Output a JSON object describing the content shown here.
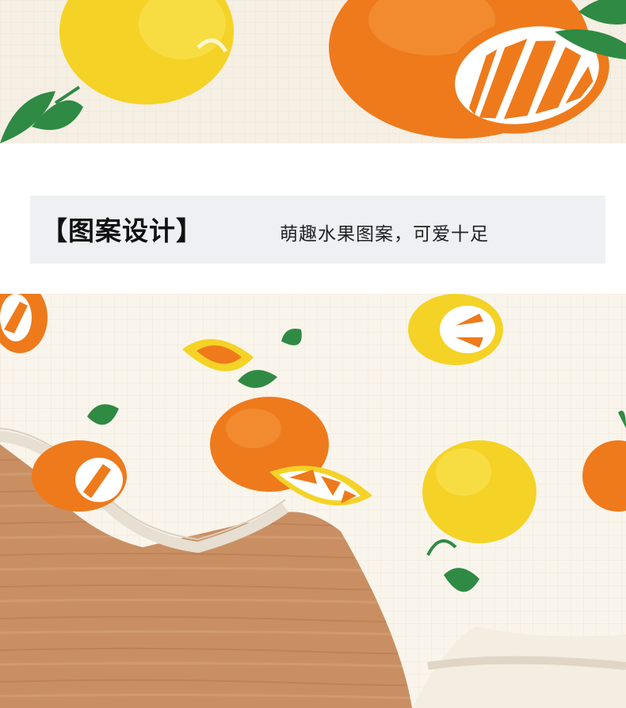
{
  "banner": {
    "title": "【图案设计】",
    "subtitle": "萌趣水果图案，可爱十足"
  },
  "colors": {
    "fabric": "#faf5ec",
    "orange": "#ee7a1c",
    "yellow": "#f5d226",
    "leaf": "#2f8a44",
    "wood": "#c98f63",
    "banner_bg": "#eef0f4"
  }
}
